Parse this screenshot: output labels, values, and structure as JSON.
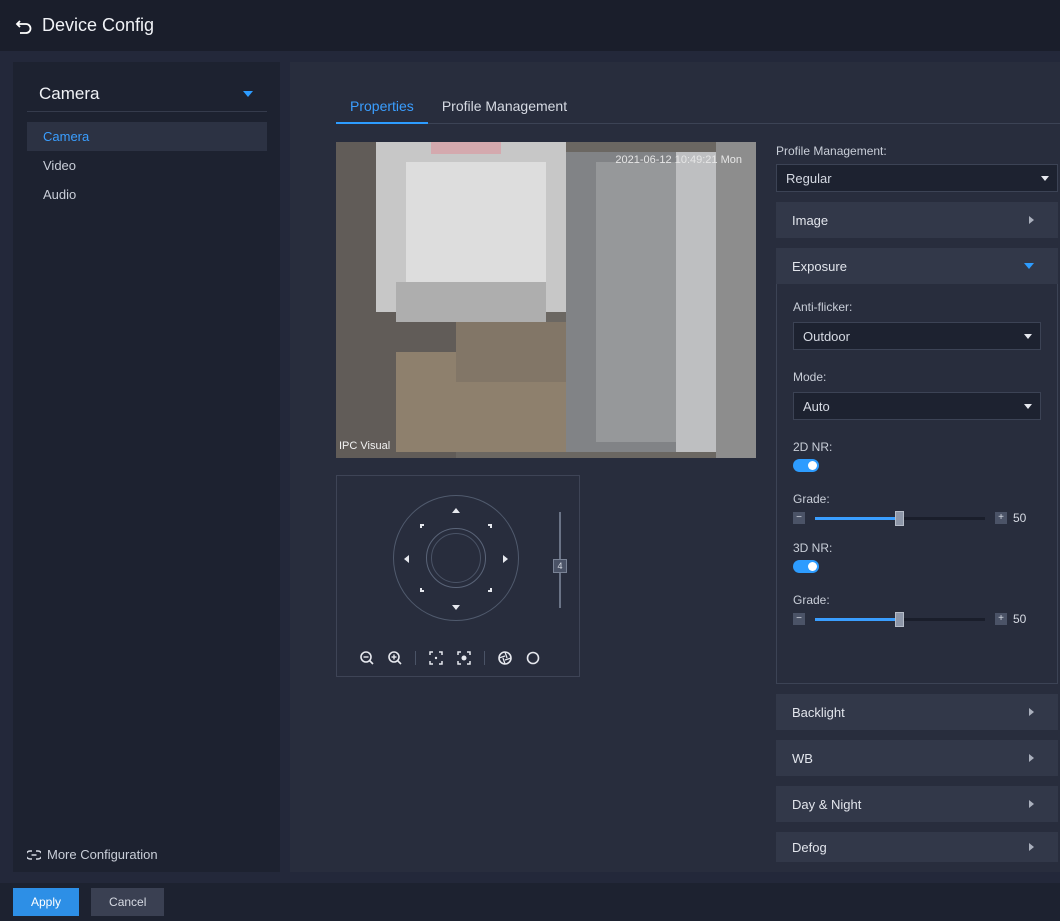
{
  "header": {
    "title": "Device Config"
  },
  "sidebar": {
    "selector_label": "Camera",
    "items": [
      {
        "label": "Camera",
        "active": true
      },
      {
        "label": "Video"
      },
      {
        "label": "Audio"
      }
    ],
    "more_config_label": "More Configuration"
  },
  "tabs": [
    {
      "label": "Properties",
      "active": true
    },
    {
      "label": "Profile Management"
    }
  ],
  "video": {
    "timestamp": "2021-06-12 10:49:21 Mon",
    "channel_label": "IPC Visual"
  },
  "ptz": {
    "zoom_level": "4"
  },
  "properties": {
    "profile_label": "Profile Management:",
    "profile_value": "Regular",
    "sections": {
      "image": "Image",
      "exposure": "Exposure",
      "backlight": "Backlight",
      "wb": "WB",
      "day_night": "Day & Night",
      "defog": "Defog"
    },
    "exposure": {
      "anti_flicker_label": "Anti-flicker:",
      "anti_flicker_value": "Outdoor",
      "mode_label": "Mode:",
      "mode_value": "Auto",
      "nr2d_label": "2D NR:",
      "nr2d_enabled": true,
      "grade1_label": "Grade:",
      "grade1_value": "50",
      "nr3d_label": "3D NR:",
      "nr3d_enabled": true,
      "grade2_label": "Grade:",
      "grade2_value": "50"
    }
  },
  "footer": {
    "apply_label": "Apply",
    "cancel_label": "Cancel"
  },
  "colors": {
    "accent": "#2d9cff",
    "background": "#23283a",
    "panel": "#282d3d"
  }
}
